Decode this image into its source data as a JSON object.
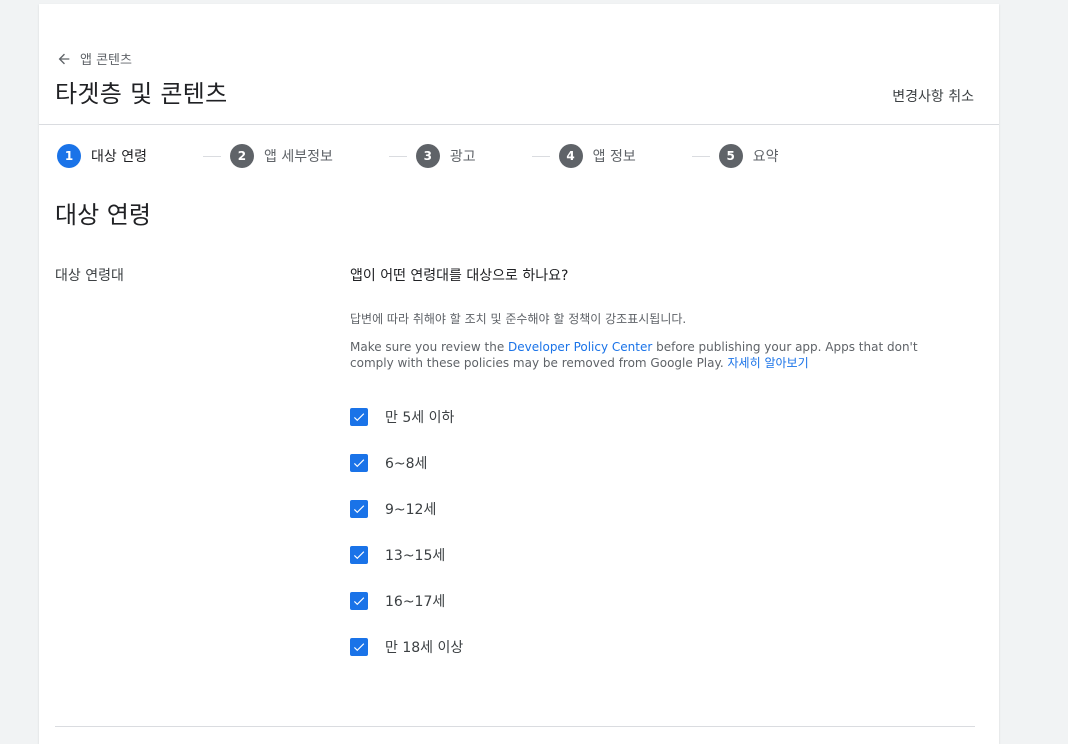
{
  "header": {
    "back_label": "앱 콘텐츠",
    "title": "타겟층 및 콘텐츠",
    "discard_label": "변경사항 취소"
  },
  "stepper": {
    "steps": [
      {
        "num": "1",
        "label": "대상 연령",
        "active": true
      },
      {
        "num": "2",
        "label": "앱 세부정보",
        "active": false
      },
      {
        "num": "3",
        "label": "광고",
        "active": false
      },
      {
        "num": "4",
        "label": "앱 정보",
        "active": false
      },
      {
        "num": "5",
        "label": "요약",
        "active": false
      }
    ]
  },
  "section": {
    "title": "대상 연령",
    "field_label": "대상 연령대",
    "question": "앱이 어떤 연령대를 대상으로 하나요?",
    "helper": "답변에 따라 취해야 할 조치 및 준수해야 할 정책이 강조표시됩니다.",
    "policy_prefix": "Make sure you review the ",
    "policy_link": "Developer Policy Center",
    "policy_middle": " before publishing your app. Apps that don't comply with these policies may be removed from Google Play. ",
    "learn_more": "자세히 알아보기"
  },
  "age_options": [
    {
      "label": "만 5세 이하",
      "checked": true
    },
    {
      "label": "6~8세",
      "checked": true
    },
    {
      "label": "9~12세",
      "checked": true
    },
    {
      "label": "13~15세",
      "checked": true
    },
    {
      "label": "16~17세",
      "checked": true
    },
    {
      "label": "만 18세 이상",
      "checked": true
    }
  ],
  "colors": {
    "accent": "#1a73e8",
    "step_inactive": "#5f6368",
    "divider": "#dadce0"
  },
  "icons": {
    "back": "arrow-back-icon",
    "check": "check-icon"
  }
}
